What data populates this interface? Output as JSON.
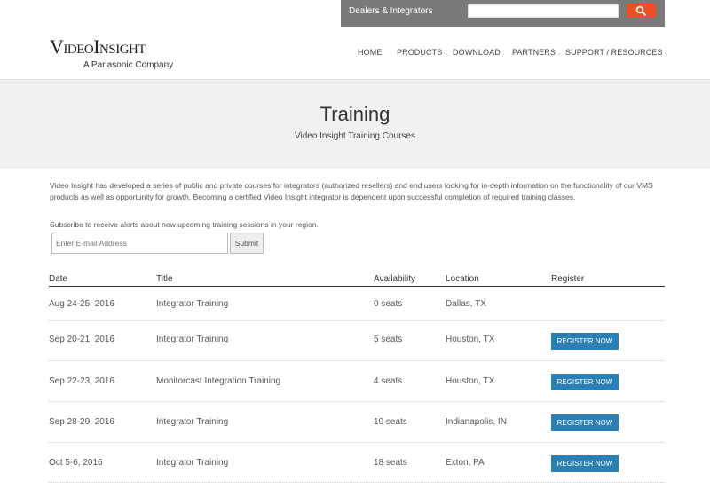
{
  "utility_bar": {
    "dealers_link": "Dealers & Integrators",
    "search_value": "",
    "search_icon": "search-icon"
  },
  "logo": {
    "wordmark": "VideoInsight",
    "subtitle": "A Panasonic Company"
  },
  "nav": {
    "items": [
      {
        "label": "HOME"
      },
      {
        "label": "PRODUCTS"
      },
      {
        "label": "DOWNLOAD"
      },
      {
        "label": "PARTNERS"
      },
      {
        "label": "SUPPORT / RESOURCES"
      }
    ]
  },
  "hero": {
    "title": "Training",
    "subtitle": "Video Insight Training Courses"
  },
  "intro": {
    "text": "Video Insight has developed a series of public and private courses for integrators (authorized resellers) and end users looking for in-depth information on the functionality of our VMS products as well as opportunity for growth. Becoming a certified Video Insight integrator is dependent upon successful completion of required training classes."
  },
  "subscribe": {
    "note": "Subscribe to receive alerts about new upcoming training sessions in your region.",
    "email_placeholder": "Enter E-mail Address",
    "submit_label": "Submit"
  },
  "table": {
    "headers": {
      "date": "Date",
      "title": "Title",
      "availability": "Availability",
      "location": "Location",
      "register": "Register"
    },
    "rows": [
      {
        "date": "Aug 24-25, 2016",
        "title": "Integrator Training",
        "availability": "0 seats",
        "location": "Dallas, TX",
        "register": ""
      },
      {
        "date": "Sep 20-21, 2016",
        "title": "Integrator Training",
        "availability": "5 seats",
        "location": "Houston, TX",
        "register": "REGISTER NOW"
      },
      {
        "date": "Sep 22-23, 2016",
        "title": "Monitorcast Integration Training",
        "availability": "4 seats",
        "location": "Houston, TX",
        "register": "REGISTER NOW"
      },
      {
        "date": "Sep 28-29, 2016",
        "title": "Integrator Training",
        "availability": "10 seats",
        "location": "Indianapolis, IN",
        "register": "REGISTER NOW"
      },
      {
        "date": "Oct 5-6, 2016",
        "title": "Integrator Training",
        "availability": "18 seats",
        "location": "Exton, PA",
        "register": "REGISTER NOW"
      }
    ]
  },
  "colors": {
    "accent": "#f04e23",
    "register_button": "#2a7fb4",
    "utility_bar": "#7a7a7a"
  }
}
